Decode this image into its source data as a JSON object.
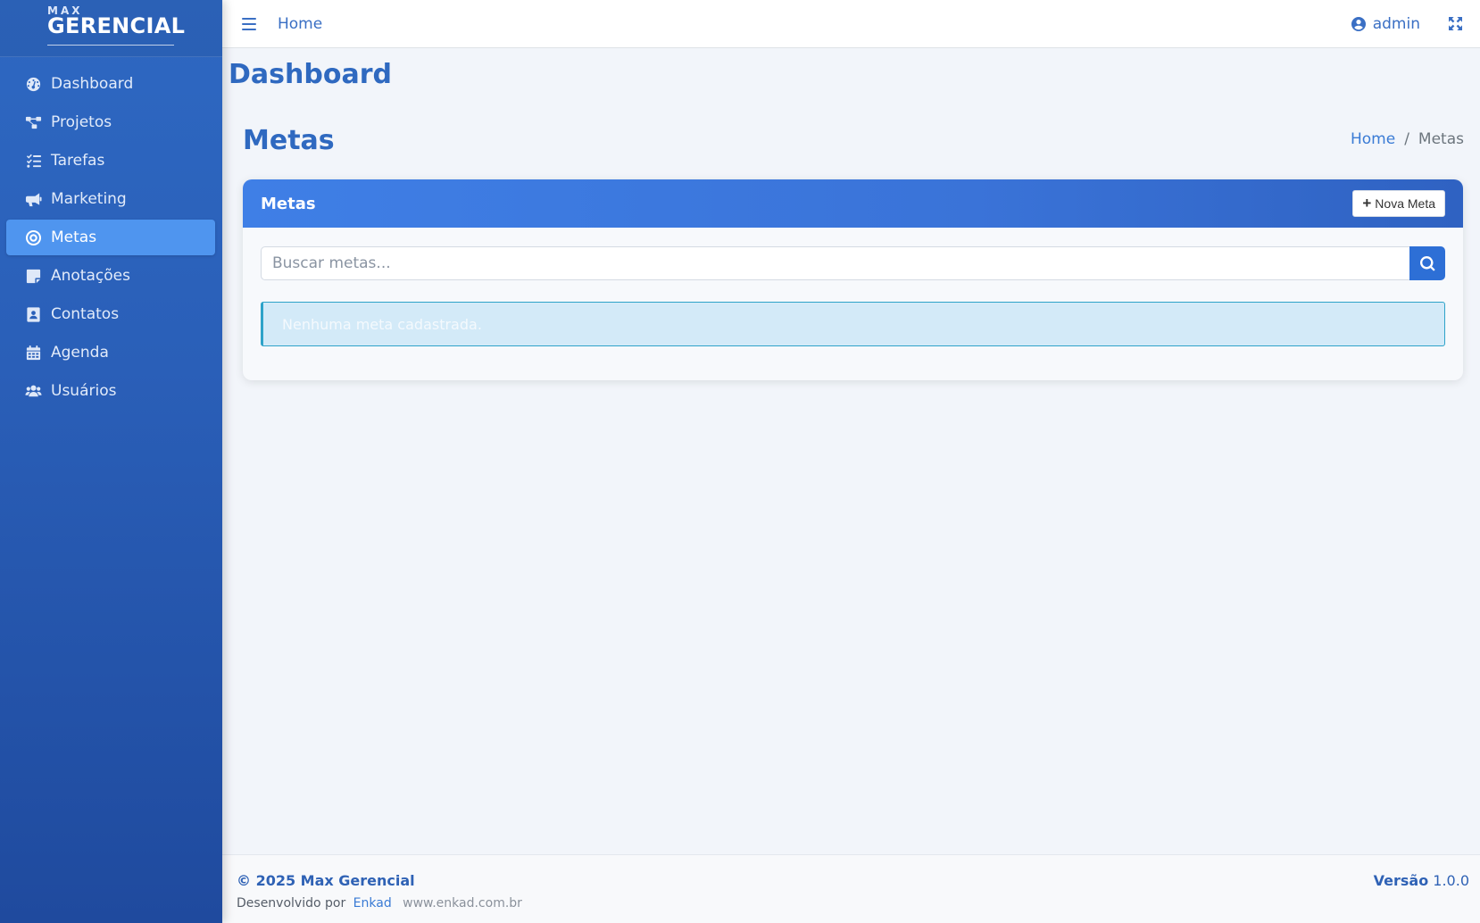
{
  "brand": {
    "small": "MAX",
    "big": "GERENCIAL"
  },
  "sidebar": {
    "items": [
      {
        "label": "Dashboard",
        "icon": "tachometer-icon",
        "active": false
      },
      {
        "label": "Projetos",
        "icon": "project-diagram-icon",
        "active": false
      },
      {
        "label": "Tarefas",
        "icon": "tasks-icon",
        "active": false
      },
      {
        "label": "Marketing",
        "icon": "bullhorn-icon",
        "active": false
      },
      {
        "label": "Metas",
        "icon": "bullseye-icon",
        "active": true
      },
      {
        "label": "Anotações",
        "icon": "sticky-note-icon",
        "active": false
      },
      {
        "label": "Contatos",
        "icon": "address-card-icon",
        "active": false
      },
      {
        "label": "Agenda",
        "icon": "calendar-icon",
        "active": false
      },
      {
        "label": "Usuários",
        "icon": "users-icon",
        "active": false
      }
    ]
  },
  "topbar": {
    "home_label": "Home",
    "user_label": "admin"
  },
  "page": {
    "heading": "Dashboard",
    "section_title": "Metas",
    "breadcrumb": {
      "home": "Home",
      "separator": "/",
      "current": "Metas"
    }
  },
  "card": {
    "title": "Metas",
    "new_button_label": "Nova Meta",
    "search_placeholder": "Buscar metas...",
    "search_value": "",
    "empty_message": "Nenhuma meta cadastrada."
  },
  "footer": {
    "copyright": "© 2025 Max Gerencial",
    "developed_by": "Desenvolvido por",
    "developer": "Enkad",
    "site": "www.enkad.com.br",
    "version_label": "Versão",
    "version_number": "1.0.0"
  },
  "colors": {
    "sidebar": "#2a5fb8",
    "active_item": "#4f95ef",
    "accent": "#2f69c0",
    "alert_bg": "#d3eaf8",
    "alert_border": "#2ea3c9"
  }
}
